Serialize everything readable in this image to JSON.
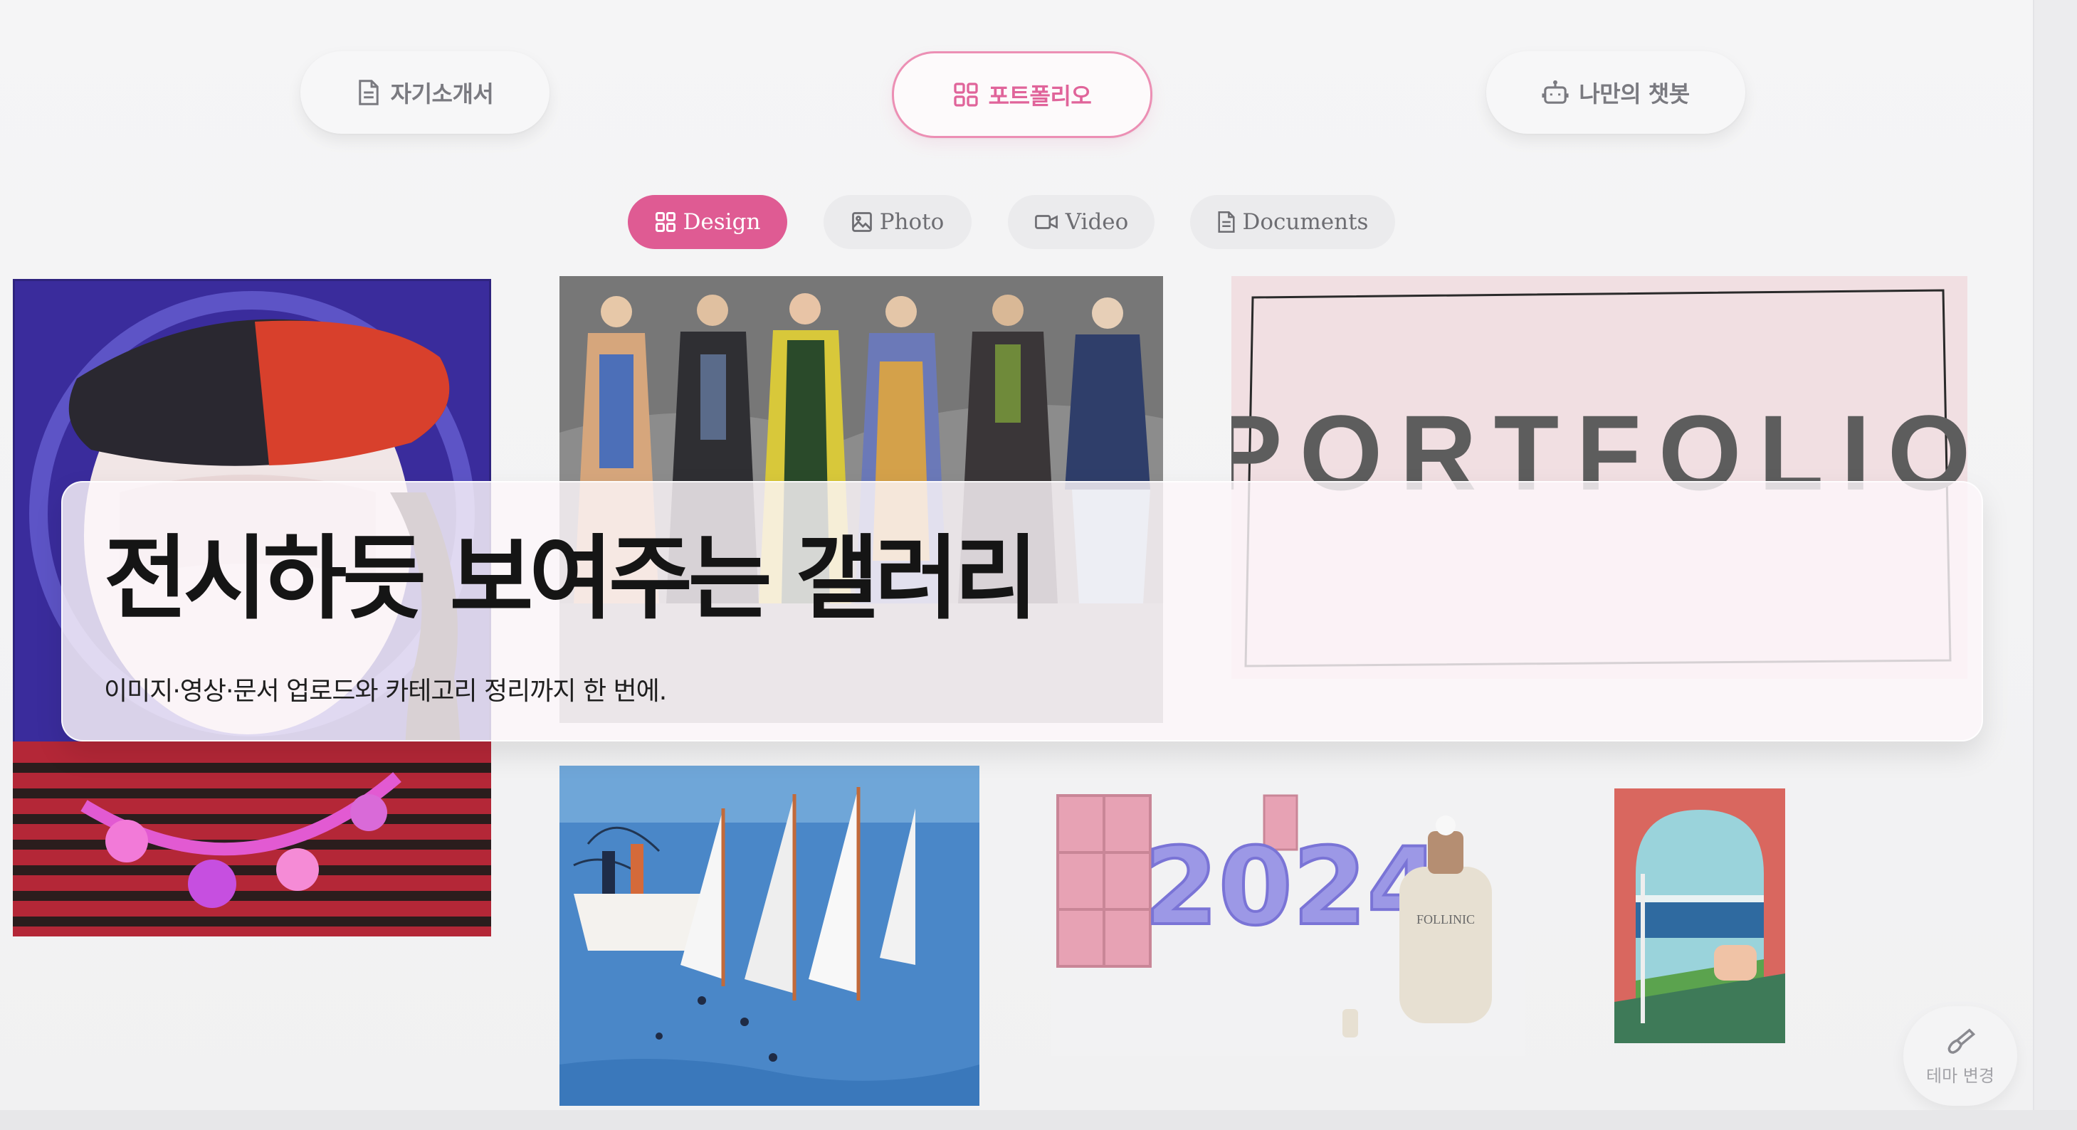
{
  "nav": {
    "intro_label": "자기소개서",
    "portfolio_label": "포트폴리오",
    "chatbot_label": "나만의 챗봇"
  },
  "categories": {
    "design": "Design",
    "photo": "Photo",
    "video": "Video",
    "documents": "Documents"
  },
  "hero": {
    "title": "전시하듯 보여주는 갤러리",
    "subtitle": "이미지·영상·문서 업로드와 카테고리 정리까지 한 번에."
  },
  "gallery": {
    "portfolio_cover_text": "PORTFOLIO",
    "poster_year": "2024",
    "bottle_label": "FOLLINIC"
  },
  "theme_button_label": "테마 변경",
  "colors": {
    "accent": "#df5b93",
    "accent_border": "#ec8fb4",
    "text_muted": "#7a7a80"
  }
}
